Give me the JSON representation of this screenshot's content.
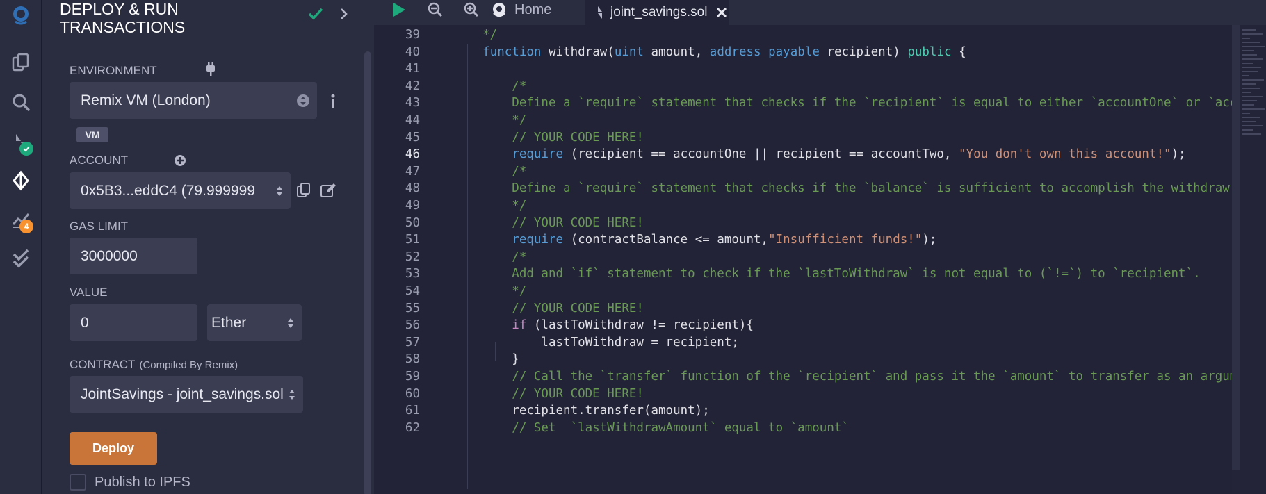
{
  "panel": {
    "title": "DEPLOY & RUN TRANSACTIONS",
    "environment": {
      "label": "ENVIRONMENT",
      "value": "Remix VM (London)",
      "badge": "VM"
    },
    "account": {
      "label": "ACCOUNT",
      "value": "0x5B3...eddC4 (79.999999"
    },
    "gas_limit": {
      "label": "GAS LIMIT",
      "value": "3000000"
    },
    "value": {
      "label": "VALUE",
      "amount": "0",
      "unit": "Ether"
    },
    "contract": {
      "label": "CONTRACT",
      "sublabel": "(Compiled By Remix)",
      "value": "JointSavings - joint_savings.sol"
    },
    "deploy_label": "Deploy",
    "publish_label": "Publish to IPFS"
  },
  "rail": {
    "icons": [
      "remix-logo-icon",
      "file-explorer-icon",
      "search-icon",
      "solidity-compiler-icon",
      "deploy-run-icon",
      "analysis-icon",
      "unit-testing-icon"
    ],
    "analysis_badge": "4",
    "colors": {
      "accent": "#1ea97c",
      "badge": "#f8912f",
      "deploy": "#c97539"
    }
  },
  "tabs": {
    "home_label": "Home",
    "file_label": "joint_savings.sol"
  },
  "editor": {
    "current_line": "46",
    "lines": [
      {
        "n": "39",
        "tokens": [
          {
            "t": "    */",
            "c": "cm"
          }
        ]
      },
      {
        "n": "40",
        "tokens": [
          {
            "t": "    ",
            "c": ""
          },
          {
            "t": "function",
            "c": "kw"
          },
          {
            "t": " withdraw(",
            "c": ""
          },
          {
            "t": "uint",
            "c": "ty"
          },
          {
            "t": " amount, ",
            "c": ""
          },
          {
            "t": "address",
            "c": "ty"
          },
          {
            "t": " ",
            "c": ""
          },
          {
            "t": "payable",
            "c": "ty"
          },
          {
            "t": " recipient) ",
            "c": ""
          },
          {
            "t": "public",
            "c": "pub"
          },
          {
            "t": " {",
            "c": ""
          }
        ]
      },
      {
        "n": "41",
        "tokens": [
          {
            "t": "",
            "c": ""
          }
        ]
      },
      {
        "n": "42",
        "tokens": [
          {
            "t": "        /*",
            "c": "cm"
          }
        ]
      },
      {
        "n": "43",
        "tokens": [
          {
            "t": "        Define a `require` statement that checks if the `recipient` is equal to either `accountOne` or `accountTwo`.",
            "c": "cm"
          }
        ]
      },
      {
        "n": "44",
        "tokens": [
          {
            "t": "        */",
            "c": "cm"
          }
        ]
      },
      {
        "n": "45",
        "tokens": [
          {
            "t": "        // YOUR CODE HERE!",
            "c": "cm"
          }
        ]
      },
      {
        "n": "46",
        "tokens": [
          {
            "t": "        ",
            "c": ""
          },
          {
            "t": "require",
            "c": "kw"
          },
          {
            "t": " (recipient == accountOne || recipient == accountTwo, ",
            "c": ""
          },
          {
            "t": "\"You don't own this account!\"",
            "c": "st"
          },
          {
            "t": ");",
            "c": ""
          }
        ]
      },
      {
        "n": "47",
        "tokens": [
          {
            "t": "        /*",
            "c": "cm"
          }
        ]
      },
      {
        "n": "48",
        "tokens": [
          {
            "t": "        Define a `require` statement that checks if the `balance` is sufficient to accomplish the withdraw operation.",
            "c": "cm"
          }
        ]
      },
      {
        "n": "49",
        "tokens": [
          {
            "t": "        */",
            "c": "cm"
          }
        ]
      },
      {
        "n": "50",
        "tokens": [
          {
            "t": "        // YOUR CODE HERE!",
            "c": "cm"
          }
        ]
      },
      {
        "n": "51",
        "tokens": [
          {
            "t": "        ",
            "c": ""
          },
          {
            "t": "require",
            "c": "kw"
          },
          {
            "t": " (contractBalance <= amount,",
            "c": ""
          },
          {
            "t": "\"Insufficient funds!\"",
            "c": "st"
          },
          {
            "t": ");",
            "c": ""
          }
        ]
      },
      {
        "n": "52",
        "tokens": [
          {
            "t": "        /*",
            "c": "cm"
          }
        ]
      },
      {
        "n": "53",
        "tokens": [
          {
            "t": "        Add and `if` statement to check if the `lastToWithdraw` is not equal to (`!=`) to `recipient`.",
            "c": "cm"
          }
        ]
      },
      {
        "n": "54",
        "tokens": [
          {
            "t": "        */",
            "c": "cm"
          }
        ]
      },
      {
        "n": "55",
        "tokens": [
          {
            "t": "        // YOUR CODE HERE!",
            "c": "cm"
          }
        ]
      },
      {
        "n": "56",
        "tokens": [
          {
            "t": "        ",
            "c": ""
          },
          {
            "t": "if",
            "c": "ifk"
          },
          {
            "t": " (lastToWithdraw != recipient){",
            "c": ""
          }
        ]
      },
      {
        "n": "57",
        "tokens": [
          {
            "t": "            lastToWithdraw = recipient;",
            "c": ""
          }
        ]
      },
      {
        "n": "58",
        "tokens": [
          {
            "t": "        }",
            "c": ""
          }
        ]
      },
      {
        "n": "59",
        "tokens": [
          {
            "t": "        // Call the `transfer` function of the `recipient` and pass it the `amount` to transfer as an argument.",
            "c": "cm"
          }
        ]
      },
      {
        "n": "60",
        "tokens": [
          {
            "t": "        // YOUR CODE HERE!",
            "c": "cm"
          }
        ]
      },
      {
        "n": "61",
        "tokens": [
          {
            "t": "        recipient.transfer(amount);",
            "c": ""
          }
        ]
      },
      {
        "n": "62",
        "tokens": [
          {
            "t": "        // Set  `lastWithdrawAmount` equal to `amount`",
            "c": "cm"
          }
        ]
      }
    ]
  }
}
